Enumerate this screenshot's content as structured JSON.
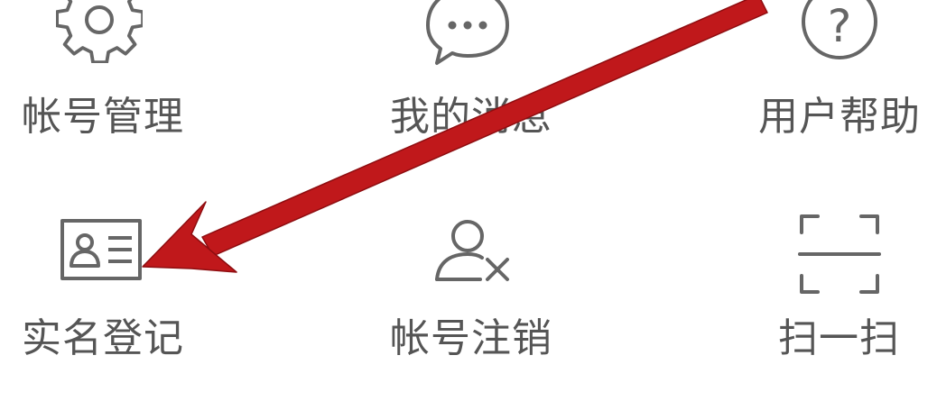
{
  "menu": {
    "items": [
      {
        "label": "帐号管理",
        "icon": "gear-icon"
      },
      {
        "label": "我的消息",
        "icon": "chat-bubble-icon"
      },
      {
        "label": "用户帮助",
        "icon": "help-circle-icon"
      },
      {
        "label": "实名登记",
        "icon": "id-card-icon"
      },
      {
        "label": "帐号注销",
        "icon": "user-remove-icon"
      },
      {
        "label": "扫一扫",
        "icon": "scan-icon"
      }
    ]
  },
  "colors": {
    "icon_stroke": "#666666",
    "label_text": "#555555",
    "annotation_arrow": "#c0181b"
  }
}
